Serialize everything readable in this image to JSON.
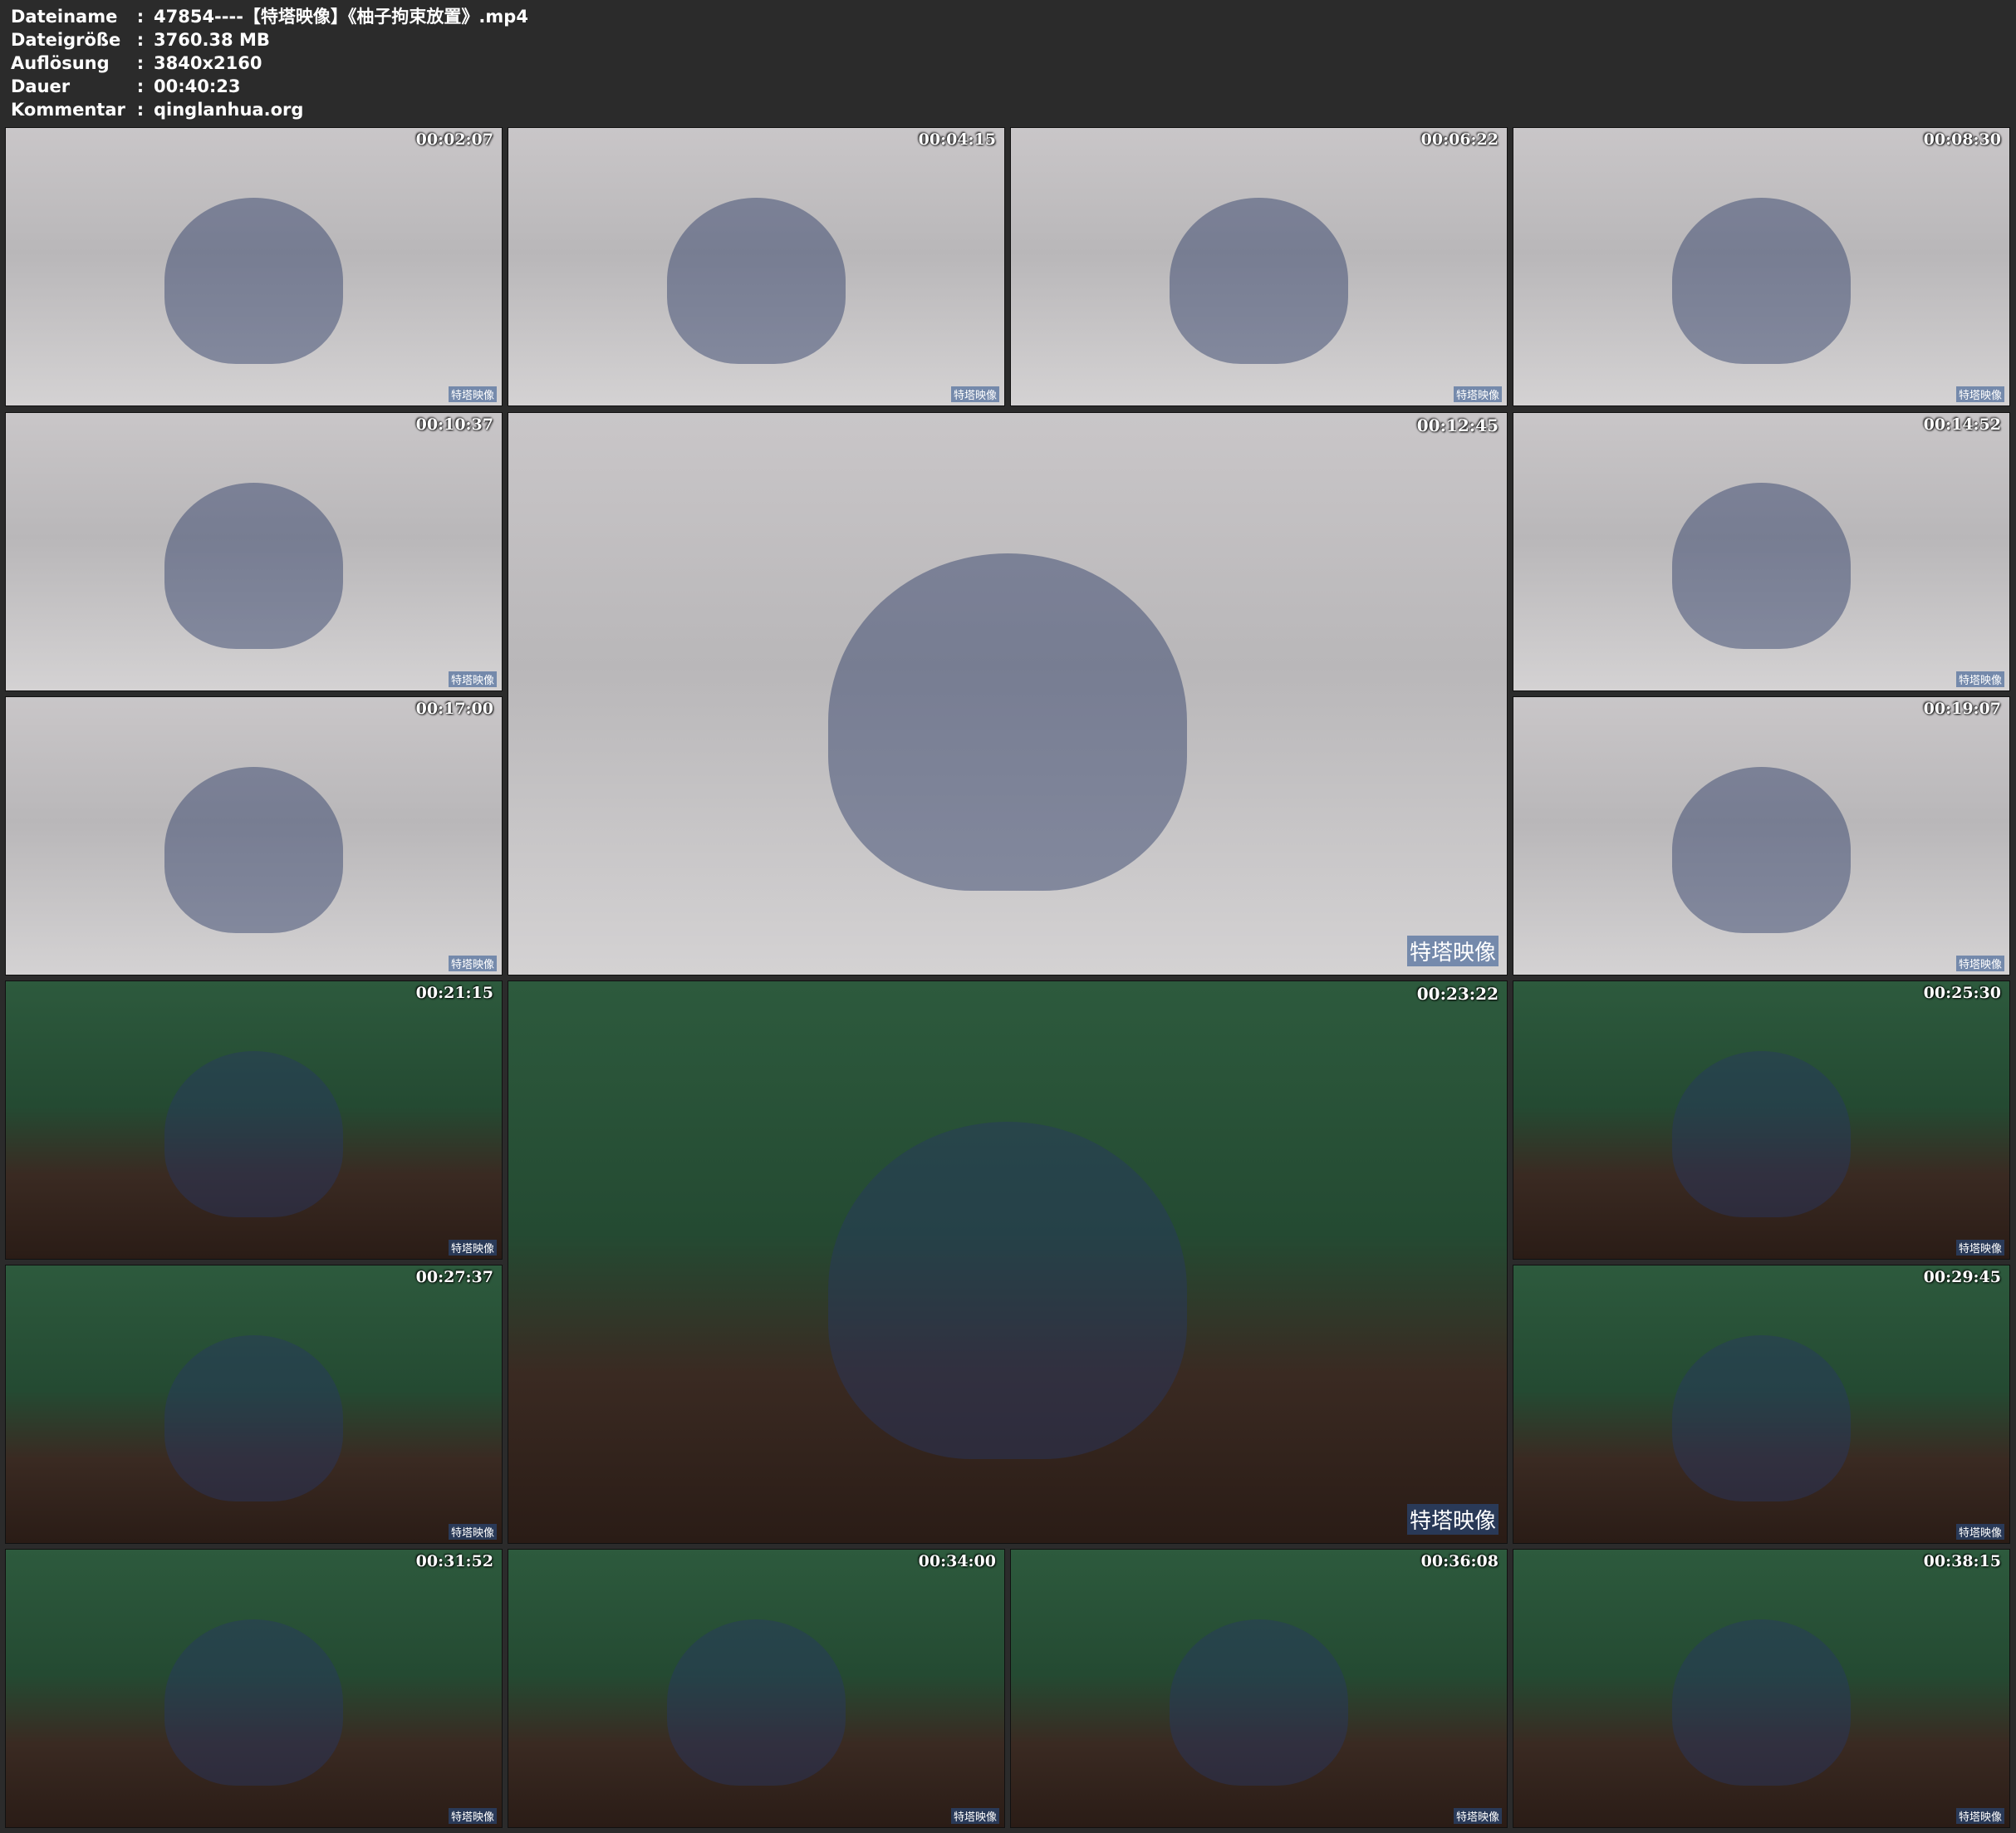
{
  "header": {
    "rows": [
      {
        "label": "Dateiname",
        "value": "47854----【特塔映像】《柚子拘束放置》.mp4"
      },
      {
        "label": "Dateigröße",
        "value": "3760.38 MB"
      },
      {
        "label": "Auflösung",
        "value": "3840x2160"
      },
      {
        "label": "Dauer",
        "value": "00:40:23"
      },
      {
        "label": "Kommentar",
        "value": "qinglanhua.org"
      }
    ],
    "separator": ":"
  },
  "watermark": "特塔映像",
  "thumbnails": [
    {
      "time": "00:02:07",
      "scene": "room"
    },
    {
      "time": "00:04:15",
      "scene": "room"
    },
    {
      "time": "00:06:22",
      "scene": "room"
    },
    {
      "time": "00:08:30",
      "scene": "room"
    },
    {
      "time": "00:10:37",
      "scene": "room"
    },
    {
      "time": "00:12:45",
      "scene": "room"
    },
    {
      "time": "00:14:52",
      "scene": "room"
    },
    {
      "time": "00:17:00",
      "scene": "room"
    },
    {
      "time": "00:19:07",
      "scene": "room"
    },
    {
      "time": "00:21:15",
      "scene": "green"
    },
    {
      "time": "00:23:22",
      "scene": "green"
    },
    {
      "time": "00:25:30",
      "scene": "green"
    },
    {
      "time": "00:27:37",
      "scene": "green"
    },
    {
      "time": "00:29:45",
      "scene": "green"
    },
    {
      "time": "00:31:52",
      "scene": "green"
    },
    {
      "time": "00:34:00",
      "scene": "green"
    },
    {
      "time": "00:36:08",
      "scene": "green"
    },
    {
      "time": "00:38:15",
      "scene": "green"
    }
  ]
}
